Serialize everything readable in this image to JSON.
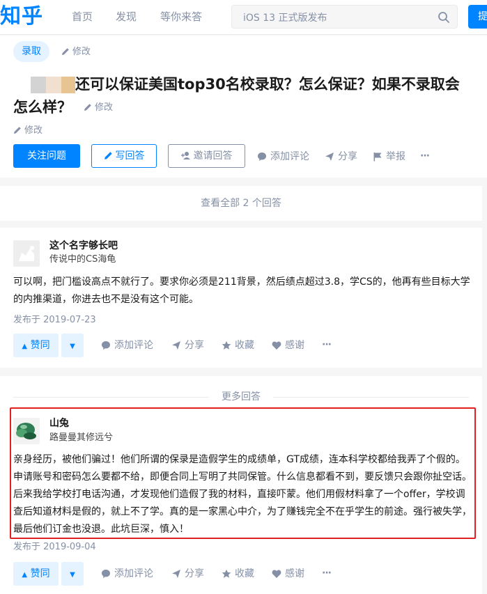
{
  "header": {
    "logo": "知乎",
    "nav": [
      "首页",
      "发现",
      "等你来答"
    ],
    "search_placeholder": "iOS 13 正式版发布",
    "ask_label": "提问"
  },
  "question": {
    "topic": "录取",
    "edit_label": "修改",
    "title_line1": "还可以保证美国top30名校录取？怎么保证？如果不录取会",
    "title_line2": "怎么样？",
    "follow_label": "关注问题",
    "write_label": "写回答",
    "invite_label": "邀请回答",
    "comment_label": "添加评论",
    "share_label": "分享",
    "report_label": "举报",
    "more_label": "···"
  },
  "view_all": "查看全部 2 个回答",
  "more_answers_label": "更多回答",
  "answers": [
    {
      "author": "这个名字够长吧",
      "headline": "传说中的CS海龟",
      "content": "可以啊，把门槛设高点不就行了。要求你必须是211背景，然后绩点超过3.8，学CS的，他再有些目标大学的内推渠道，你进去也不是没有这个可能。",
      "date": "发布于 2019-07-23",
      "vote_label": "赞同",
      "comment_label": "添加评论",
      "share_label": "分享",
      "collect_label": "收藏",
      "thanks_label": "感谢",
      "more_label": "···"
    },
    {
      "author": "山兔",
      "headline": "路曼曼其修远兮",
      "content": "亲身经历，被他们骗过！他们所谓的保录是造假学生的成绩单，GT成绩，连本科学校都给我弄了个假的。申请账号和密码怎么要都不给，即便合同上写明了共同保管。什么信息都看不到，要反馈只会跟你扯空话。后来我给学校打电话沟通，才发现他们造假了我的材料，直接吓蒙。他们用假材料拿了一个offer，学校调查后知道材料是假的，就上不了学。真的是一家黑心中介，为了赚钱完全不在乎学生的前途。强行被失学，最后他们订金也没退。此坑巨深，慎入！",
      "date": "发布于 2019-09-04",
      "vote_label": "赞同",
      "comment_label": "添加评论",
      "share_label": "分享",
      "collect_label": "收藏",
      "thanks_label": "感谢",
      "more_label": "···"
    }
  ],
  "colors": {
    "brand": "#0084ff",
    "muted": "#8590a6",
    "highlight": "#e02020"
  }
}
